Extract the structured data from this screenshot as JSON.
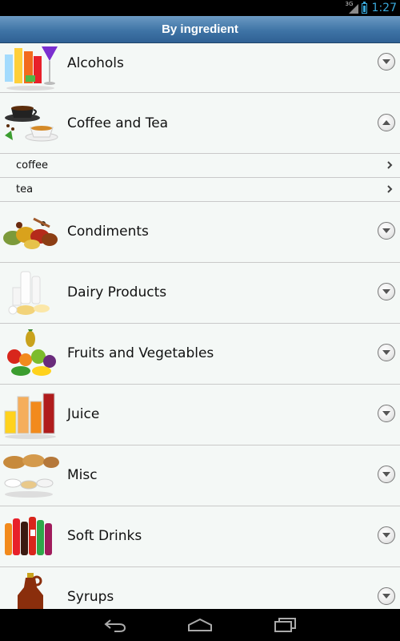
{
  "status_bar": {
    "network": "3G",
    "time": "1:27"
  },
  "header": {
    "title": "By ingredient"
  },
  "categories": [
    {
      "label": "Alcohols",
      "icon": "cocktail-glasses",
      "expanded": false
    },
    {
      "label": "Coffee and Tea",
      "icon": "coffee-cup",
      "expanded": true,
      "children": [
        {
          "label": "coffee"
        },
        {
          "label": "tea"
        }
      ]
    },
    {
      "label": "Condiments",
      "icon": "spice-piles",
      "expanded": false
    },
    {
      "label": "Dairy Products",
      "icon": "milk-bottles",
      "expanded": false
    },
    {
      "label": "Fruits and Vegetables",
      "icon": "fruit-basket",
      "expanded": false
    },
    {
      "label": "Juice",
      "icon": "juice-glasses",
      "expanded": false
    },
    {
      "label": "Misc",
      "icon": "bread-and-bowls",
      "expanded": false
    },
    {
      "label": "Soft Drinks",
      "icon": "soda-bottles",
      "expanded": false
    },
    {
      "label": "Syrups",
      "icon": "syrup-bottle",
      "expanded": false
    }
  ],
  "colors": {
    "accent": "#39a9db",
    "header": "#3f74a6",
    "list_bg": "#f4f8f6"
  },
  "nav_bar": {
    "buttons": [
      "back-icon",
      "home-icon",
      "recent-apps-icon"
    ]
  }
}
